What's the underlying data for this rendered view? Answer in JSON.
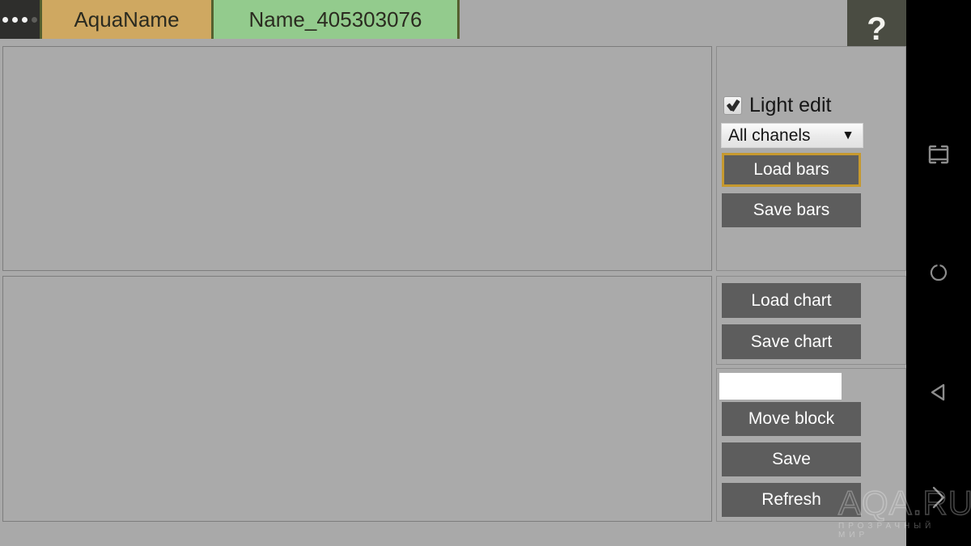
{
  "titlebar": {
    "overflow_label": "...",
    "tabs": [
      {
        "label": "AquaName",
        "color": "#cfa861"
      },
      {
        "label": "Name_405303076",
        "color": "#93cb8d"
      }
    ],
    "help_label": "?"
  },
  "panels": {
    "bars_area_name": "bars editor canvas",
    "chart_area_name": "chart canvas"
  },
  "controls": {
    "bars": {
      "light_edit_label": "Light edit",
      "light_edit_checked": true,
      "channel_select_value": "All chanels",
      "channel_select_caret": "▼",
      "load_label": "Load bars",
      "save_label": "Save bars",
      "focus_color": "#c6992f"
    },
    "chart": {
      "load_label": "Load chart",
      "save_label": "Save chart"
    },
    "block": {
      "input_value": "",
      "input_placeholder": "",
      "move_label": "Move block",
      "save_label": "Save",
      "refresh_label": "Refresh"
    }
  },
  "navbar": {
    "recents_icon": "recents-square-icon",
    "home_icon": "home-circle-icon",
    "back_icon": "back-triangle-icon",
    "expand_icon": "chevron-right-icon"
  },
  "watermark": {
    "main": "AQA.RU",
    "sub": "ПРОЗРАЧНЫЙ МИР"
  },
  "theme": {
    "background": "#a9a9a9",
    "button": "#5d5d5d",
    "tab_active": "#93cb8d",
    "tab_inactive": "#cfa861",
    "navbar": "#000000"
  }
}
